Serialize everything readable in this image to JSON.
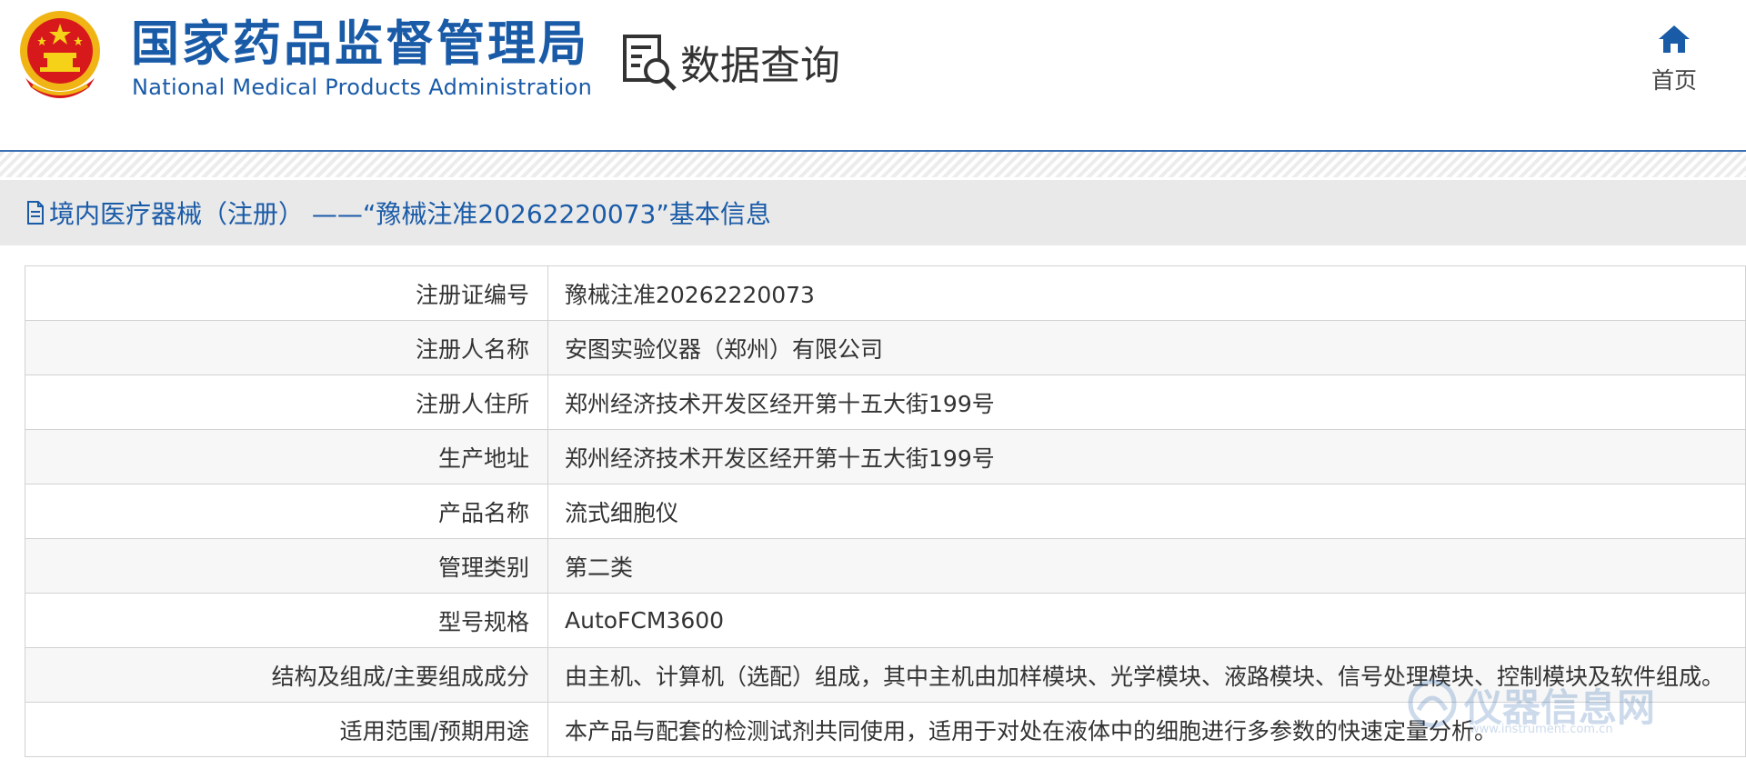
{
  "header": {
    "title_cn": "国家药品监督管理局",
    "title_en": "National Medical Products Administration",
    "query_label": "数据查询",
    "home_label": "首页"
  },
  "info": {
    "title": "境内医疗器械（注册） ——“豫械注准20262220073”基本信息"
  },
  "rows": [
    {
      "label": "注册证编号",
      "value": "豫械注准20262220073"
    },
    {
      "label": "注册人名称",
      "value": "安图实验仪器（郑州）有限公司"
    },
    {
      "label": "注册人住所",
      "value": "郑州经济技术开发区经开第十五大街199号"
    },
    {
      "label": "生产地址",
      "value": "郑州经济技术开发区经开第十五大街199号"
    },
    {
      "label": "产品名称",
      "value": "流式细胞仪"
    },
    {
      "label": "管理类别",
      "value": "第二类"
    },
    {
      "label": "型号规格",
      "value": "AutoFCM3600"
    },
    {
      "label": "结构及组成/主要组成成分",
      "value": "由主机、计算机（选配）组成，其中主机由加样模块、光学模块、液路模块、信号处理模块、控制模块及软件组成。"
    },
    {
      "label": "适用范围/预期用途",
      "value": "本产品与配套的检测试剂共同使用，适用于对处在液体中的细胞进行多参数的快速定量分析。"
    }
  ],
  "watermark": {
    "text": "仪器信息网",
    "url": "www.instrument.com.cn"
  },
  "colors": {
    "brand_blue": "#1a5ba8",
    "emblem_red": "#d7191c",
    "emblem_gold": "#f5c518"
  }
}
